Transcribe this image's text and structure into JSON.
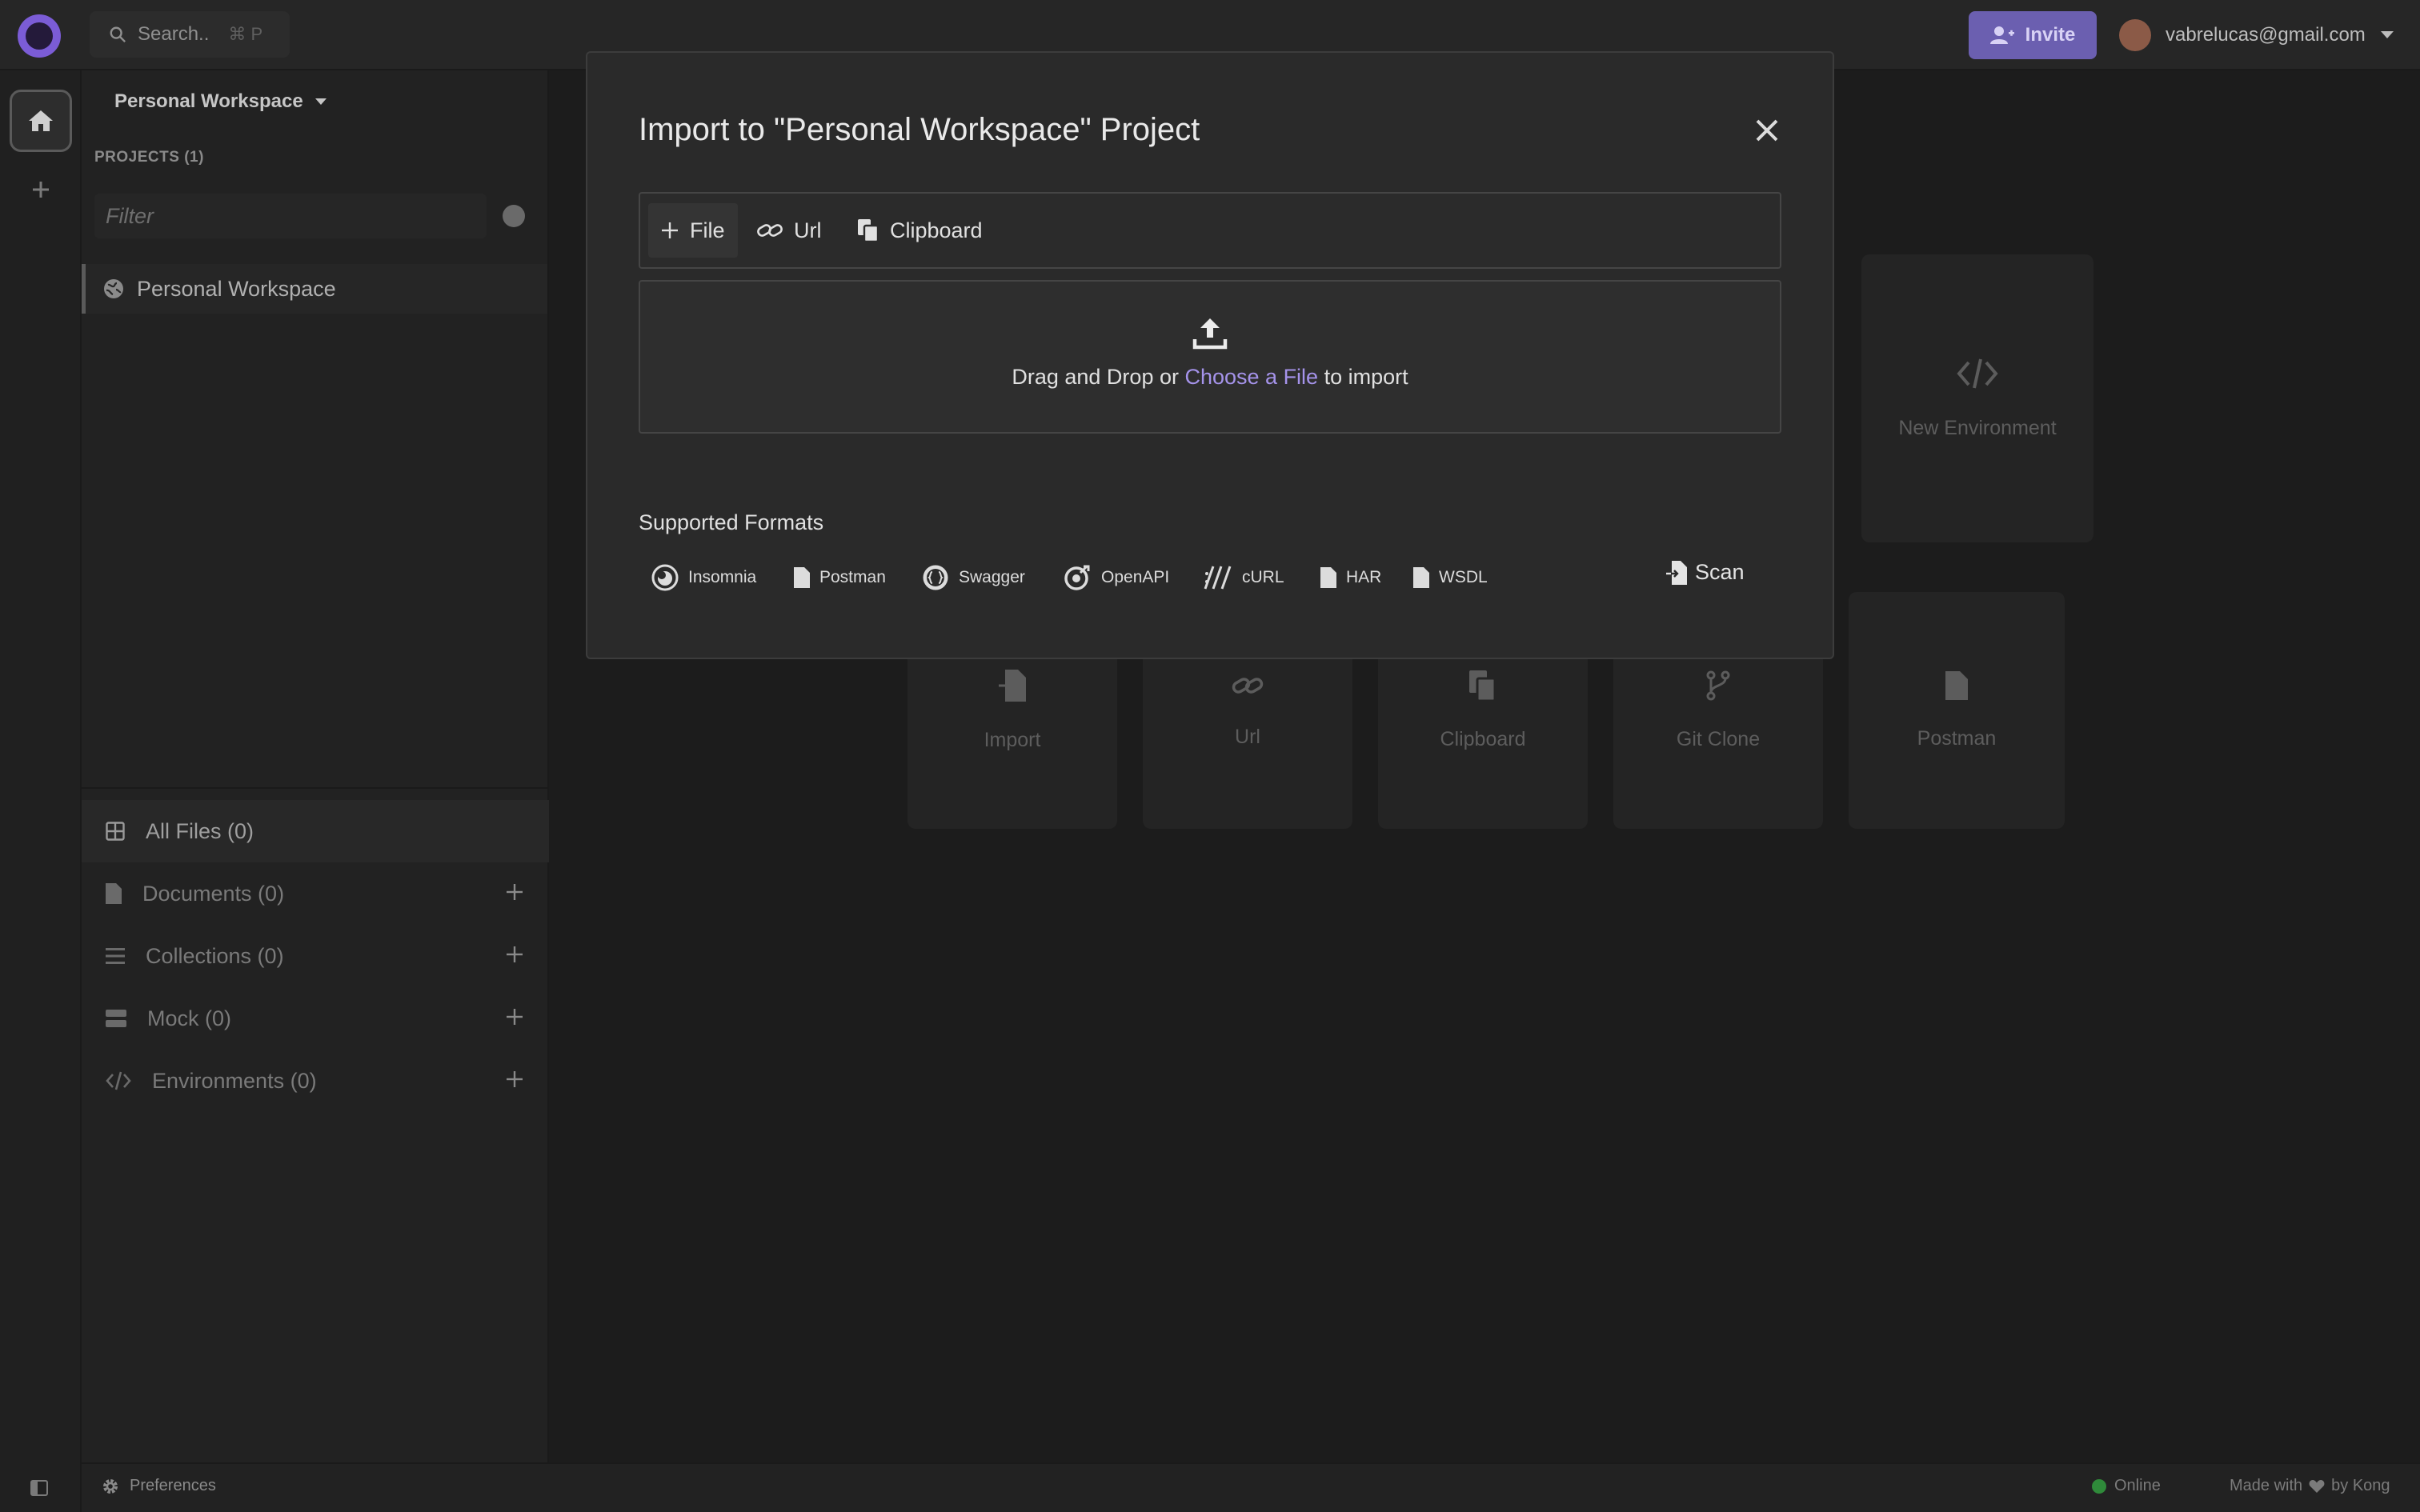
{
  "header": {
    "search_placeholder": "Search..",
    "search_shortcut": "⌘ P",
    "invite_label": "Invite",
    "user_email": "vabrelucas@gmail.com"
  },
  "sidebar": {
    "workspace_selector": "Personal Workspace",
    "projects_label": "PROJECTS (1)",
    "filter_placeholder": "Filter",
    "projects": [
      {
        "name": "Personal Workspace"
      }
    ],
    "file_groups": [
      {
        "label": "All Files (0)"
      },
      {
        "label": "Documents (0)"
      },
      {
        "label": "Collections (0)"
      },
      {
        "label": "Mock (0)"
      },
      {
        "label": "Environments (0)"
      }
    ]
  },
  "background_cards": {
    "top": [
      {
        "label": "New Environment",
        "icon": "code-icon"
      }
    ],
    "bottom": [
      {
        "label": "Import",
        "icon": "import-file-icon"
      },
      {
        "label": "Url",
        "icon": "link-icon"
      },
      {
        "label": "Clipboard",
        "icon": "clipboard-icon"
      },
      {
        "label": "Git Clone",
        "icon": "git-branch-icon"
      },
      {
        "label": "Postman",
        "icon": "file-icon"
      }
    ]
  },
  "modal": {
    "title": "Import to \"Personal Workspace\" Project",
    "tabs": [
      {
        "label": "File",
        "icon": "plus-icon",
        "active": true
      },
      {
        "label": "Url",
        "icon": "link-icon",
        "active": false
      },
      {
        "label": "Clipboard",
        "icon": "clipboard-icon",
        "active": false
      }
    ],
    "drop": {
      "prefix": "Drag and Drop or",
      "link": "Choose a File",
      "suffix": "to import"
    },
    "supported_formats_title": "Supported Formats",
    "formats": [
      {
        "label": "Insomnia",
        "icon": "insomnia-icon"
      },
      {
        "label": "Postman",
        "icon": "file-icon"
      },
      {
        "label": "Swagger",
        "icon": "swagger-icon"
      },
      {
        "label": "OpenAPI",
        "icon": "openapi-icon"
      },
      {
        "label": "cURL",
        "icon": "curl-icon"
      },
      {
        "label": "HAR",
        "icon": "file-icon"
      },
      {
        "label": "WSDL",
        "icon": "file-icon"
      }
    ],
    "scan_label": "Scan"
  },
  "footer": {
    "preferences_label": "Preferences",
    "status_label": "Online",
    "made_with_prefix": "Made with",
    "made_with_suffix": "by Kong"
  },
  "colors": {
    "accent": "#a593ea",
    "invite_bg": "#6b5fb0",
    "online": "#2f8a3a"
  }
}
